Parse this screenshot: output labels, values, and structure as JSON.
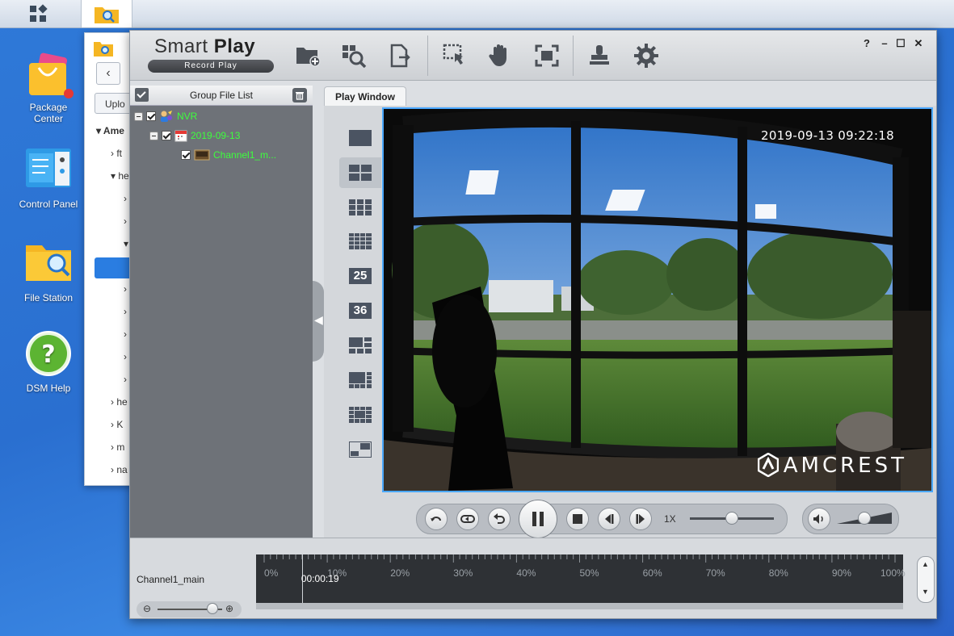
{
  "desktop": {
    "icons": [
      {
        "label_line1": "Package",
        "label_line2": "Center"
      },
      {
        "label_line1": "Control Panel"
      },
      {
        "label_line1": "File Station"
      },
      {
        "label_line1": "DSM Help"
      }
    ]
  },
  "file_station": {
    "upload_label": "Uplo",
    "tree": [
      "Ame",
      "ft",
      "he",
      "he",
      "K",
      "m",
      "na"
    ]
  },
  "app": {
    "title_light": "Smart",
    "title_bold": "Play",
    "subtitle": "Record Play",
    "window_controls": {
      "help": "?",
      "minimize": "–",
      "maximize": "☐",
      "close": "✕"
    }
  },
  "file_list": {
    "header": "Group File List",
    "tree": [
      {
        "label": "NVR"
      },
      {
        "label": "2019-09-13"
      },
      {
        "label": "Channel1_m..."
      }
    ]
  },
  "play_window": {
    "tab_label": "Play Window",
    "layouts": [
      "1",
      "4",
      "9",
      "16",
      "25",
      "36",
      "custom-a",
      "custom-b",
      "custom-c",
      "custom-d"
    ],
    "layout_25": "25",
    "layout_36": "36",
    "selected_layout": "4",
    "timestamp": "2019-09-13 09:22:18",
    "brand": "AMCREST"
  },
  "playback": {
    "speed": "1X",
    "speed_slider_fraction": 0.5,
    "volume_fraction": 0.5
  },
  "timeline": {
    "channel_label": "Channel1_main",
    "current_time": "00:00:19",
    "position_fraction": 0.06,
    "ticks": [
      "0%",
      "10%",
      "20%",
      "30%",
      "40%",
      "50%",
      "60%",
      "70%",
      "80%",
      "90%",
      "100%"
    ],
    "zoom_fraction": 0.85
  },
  "colors": {
    "accent": "#4aa8ff",
    "tree_text": "#3dff3d",
    "desktop_bg": "#2f79d8"
  }
}
